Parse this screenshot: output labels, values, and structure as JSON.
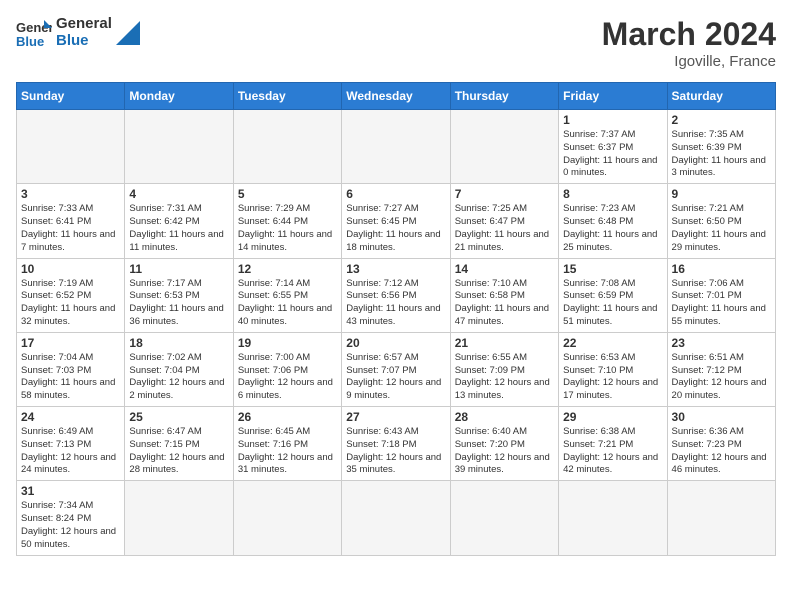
{
  "logo": {
    "text_general": "General",
    "text_blue": "Blue"
  },
  "title": "March 2024",
  "location": "Igoville, France",
  "weekdays": [
    "Sunday",
    "Monday",
    "Tuesday",
    "Wednesday",
    "Thursday",
    "Friday",
    "Saturday"
  ],
  "weeks": [
    [
      {
        "day": "",
        "info": "",
        "empty": true
      },
      {
        "day": "",
        "info": "",
        "empty": true
      },
      {
        "day": "",
        "info": "",
        "empty": true
      },
      {
        "day": "",
        "info": "",
        "empty": true
      },
      {
        "day": "",
        "info": "",
        "empty": true
      },
      {
        "day": "1",
        "info": "Sunrise: 7:37 AM\nSunset: 6:37 PM\nDaylight: 11 hours and 0 minutes.",
        "empty": false
      },
      {
        "day": "2",
        "info": "Sunrise: 7:35 AM\nSunset: 6:39 PM\nDaylight: 11 hours and 3 minutes.",
        "empty": false
      }
    ],
    [
      {
        "day": "3",
        "info": "Sunrise: 7:33 AM\nSunset: 6:41 PM\nDaylight: 11 hours and 7 minutes.",
        "empty": false
      },
      {
        "day": "4",
        "info": "Sunrise: 7:31 AM\nSunset: 6:42 PM\nDaylight: 11 hours and 11 minutes.",
        "empty": false
      },
      {
        "day": "5",
        "info": "Sunrise: 7:29 AM\nSunset: 6:44 PM\nDaylight: 11 hours and 14 minutes.",
        "empty": false
      },
      {
        "day": "6",
        "info": "Sunrise: 7:27 AM\nSunset: 6:45 PM\nDaylight: 11 hours and 18 minutes.",
        "empty": false
      },
      {
        "day": "7",
        "info": "Sunrise: 7:25 AM\nSunset: 6:47 PM\nDaylight: 11 hours and 21 minutes.",
        "empty": false
      },
      {
        "day": "8",
        "info": "Sunrise: 7:23 AM\nSunset: 6:48 PM\nDaylight: 11 hours and 25 minutes.",
        "empty": false
      },
      {
        "day": "9",
        "info": "Sunrise: 7:21 AM\nSunset: 6:50 PM\nDaylight: 11 hours and 29 minutes.",
        "empty": false
      }
    ],
    [
      {
        "day": "10",
        "info": "Sunrise: 7:19 AM\nSunset: 6:52 PM\nDaylight: 11 hours and 32 minutes.",
        "empty": false
      },
      {
        "day": "11",
        "info": "Sunrise: 7:17 AM\nSunset: 6:53 PM\nDaylight: 11 hours and 36 minutes.",
        "empty": false
      },
      {
        "day": "12",
        "info": "Sunrise: 7:14 AM\nSunset: 6:55 PM\nDaylight: 11 hours and 40 minutes.",
        "empty": false
      },
      {
        "day": "13",
        "info": "Sunrise: 7:12 AM\nSunset: 6:56 PM\nDaylight: 11 hours and 43 minutes.",
        "empty": false
      },
      {
        "day": "14",
        "info": "Sunrise: 7:10 AM\nSunset: 6:58 PM\nDaylight: 11 hours and 47 minutes.",
        "empty": false
      },
      {
        "day": "15",
        "info": "Sunrise: 7:08 AM\nSunset: 6:59 PM\nDaylight: 11 hours and 51 minutes.",
        "empty": false
      },
      {
        "day": "16",
        "info": "Sunrise: 7:06 AM\nSunset: 7:01 PM\nDaylight: 11 hours and 55 minutes.",
        "empty": false
      }
    ],
    [
      {
        "day": "17",
        "info": "Sunrise: 7:04 AM\nSunset: 7:03 PM\nDaylight: 11 hours and 58 minutes.",
        "empty": false
      },
      {
        "day": "18",
        "info": "Sunrise: 7:02 AM\nSunset: 7:04 PM\nDaylight: 12 hours and 2 minutes.",
        "empty": false
      },
      {
        "day": "19",
        "info": "Sunrise: 7:00 AM\nSunset: 7:06 PM\nDaylight: 12 hours and 6 minutes.",
        "empty": false
      },
      {
        "day": "20",
        "info": "Sunrise: 6:57 AM\nSunset: 7:07 PM\nDaylight: 12 hours and 9 minutes.",
        "empty": false
      },
      {
        "day": "21",
        "info": "Sunrise: 6:55 AM\nSunset: 7:09 PM\nDaylight: 12 hours and 13 minutes.",
        "empty": false
      },
      {
        "day": "22",
        "info": "Sunrise: 6:53 AM\nSunset: 7:10 PM\nDaylight: 12 hours and 17 minutes.",
        "empty": false
      },
      {
        "day": "23",
        "info": "Sunrise: 6:51 AM\nSunset: 7:12 PM\nDaylight: 12 hours and 20 minutes.",
        "empty": false
      }
    ],
    [
      {
        "day": "24",
        "info": "Sunrise: 6:49 AM\nSunset: 7:13 PM\nDaylight: 12 hours and 24 minutes.",
        "empty": false
      },
      {
        "day": "25",
        "info": "Sunrise: 6:47 AM\nSunset: 7:15 PM\nDaylight: 12 hours and 28 minutes.",
        "empty": false
      },
      {
        "day": "26",
        "info": "Sunrise: 6:45 AM\nSunset: 7:16 PM\nDaylight: 12 hours and 31 minutes.",
        "empty": false
      },
      {
        "day": "27",
        "info": "Sunrise: 6:43 AM\nSunset: 7:18 PM\nDaylight: 12 hours and 35 minutes.",
        "empty": false
      },
      {
        "day": "28",
        "info": "Sunrise: 6:40 AM\nSunset: 7:20 PM\nDaylight: 12 hours and 39 minutes.",
        "empty": false
      },
      {
        "day": "29",
        "info": "Sunrise: 6:38 AM\nSunset: 7:21 PM\nDaylight: 12 hours and 42 minutes.",
        "empty": false
      },
      {
        "day": "30",
        "info": "Sunrise: 6:36 AM\nSunset: 7:23 PM\nDaylight: 12 hours and 46 minutes.",
        "empty": false
      }
    ],
    [
      {
        "day": "31",
        "info": "Sunrise: 7:34 AM\nSunset: 8:24 PM\nDaylight: 12 hours and 50 minutes.",
        "empty": false
      },
      {
        "day": "",
        "info": "",
        "empty": true
      },
      {
        "day": "",
        "info": "",
        "empty": true
      },
      {
        "day": "",
        "info": "",
        "empty": true
      },
      {
        "day": "",
        "info": "",
        "empty": true
      },
      {
        "day": "",
        "info": "",
        "empty": true
      },
      {
        "day": "",
        "info": "",
        "empty": true
      }
    ]
  ]
}
